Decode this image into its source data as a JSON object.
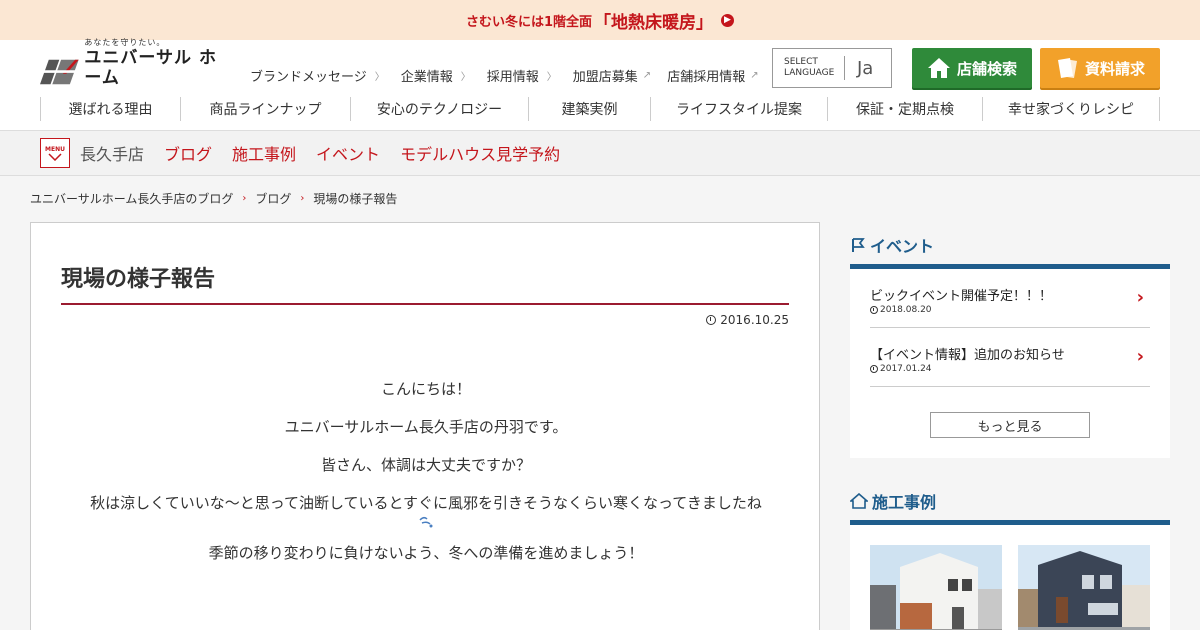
{
  "banner": {
    "prefix": "さむい冬には1階全面",
    "highlight": "「地熱床暖房」"
  },
  "header": {
    "logo_tagline": "あなたを守りたい。",
    "logo_name": "ユニバーサル ホーム",
    "util_nav": [
      {
        "label": "ブランドメッセージ",
        "external": false
      },
      {
        "label": "企業情報",
        "external": false
      },
      {
        "label": "採用情報",
        "external": false
      },
      {
        "label": "加盟店募集",
        "external": true
      },
      {
        "label": "店舗採用情報",
        "external": true
      }
    ],
    "language": {
      "line1": "SELECT",
      "line2": "LANGUAGE",
      "current": "Ja"
    },
    "store_search_label": "店舗検索",
    "document_request_label": "資料請求",
    "main_nav": [
      "選ばれる理由",
      "商品ラインナップ",
      "安心のテクノロジー",
      "建築実例",
      "ライフスタイル提案",
      "保証・定期点検",
      "幸せ家づくりレシピ"
    ]
  },
  "storebar": {
    "menu_label": "MENU",
    "store_name": "長久手店",
    "links": [
      "ブログ",
      "施工事例",
      "イベント",
      "モデルハウス見学予約"
    ]
  },
  "breadcrumb": [
    "ユニバーサルホーム長久手店のブログ",
    "ブログ",
    "現場の様子報告"
  ],
  "article": {
    "title": "現場の様子報告",
    "date": "2016.10.25",
    "paragraphs": [
      "こんにちは！",
      "ユニバーサルホーム長久手店の丹羽です。",
      "皆さん、体調は大丈夫ですか？",
      "秋は涼しくていいな～と思って油断しているとすぐに風邪を引きそうなくらい寒くなってきましたね",
      "季節の移り変わりに負けないよう、冬への準備を進めましょう！"
    ]
  },
  "sidebar": {
    "events_heading": "イベント",
    "events": [
      {
        "title": "ビックイベント開催予定！！！",
        "date": "2018.08.20"
      },
      {
        "title": "【イベント情報】追加のお知らせ",
        "date": "2017.01.24"
      }
    ],
    "more_label": "もっと見る",
    "works_heading": "施工事例"
  },
  "colors": {
    "brand_red": "#c4161c",
    "green": "#2f8a3a",
    "orange": "#f2a12a",
    "navy": "#1f5d8c"
  }
}
